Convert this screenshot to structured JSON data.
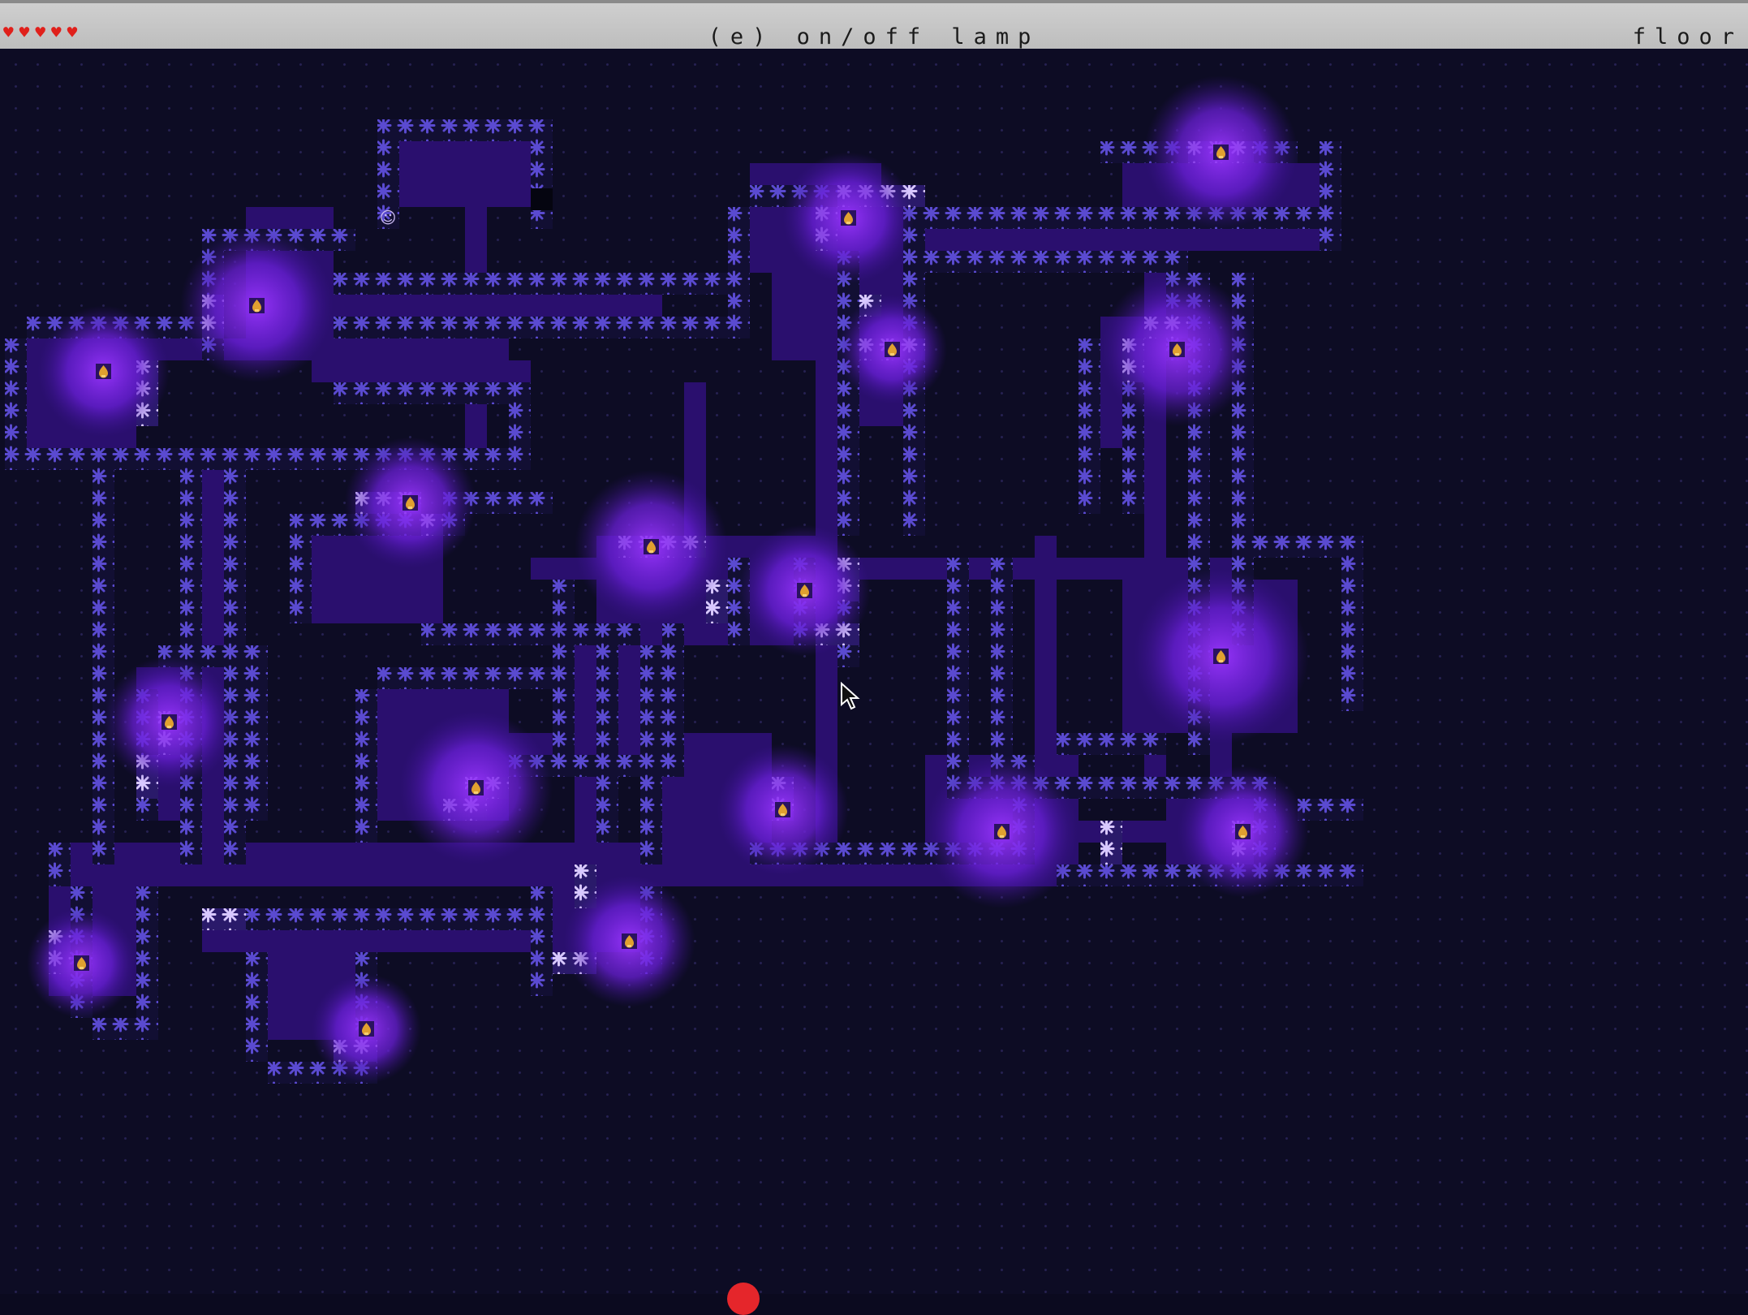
{
  "hud": {
    "hearts": 5,
    "heart_glyph": "♥",
    "prompt": "(e) on/off lamp",
    "tile_name": "floor"
  },
  "player_glyph": "☺",
  "colors": {
    "heart": "#e0201b",
    "wall": "#4a3fc4",
    "wall_lit": "#c8b8f0",
    "floor_dark": "#2a0f6e",
    "lamp_glow": "#8a2af0",
    "lamp": "#e0a030"
  },
  "icons": [
    "heart-icon",
    "lamp-icon",
    "player-icon",
    "cursor-icon",
    "record-dot-icon"
  ]
}
